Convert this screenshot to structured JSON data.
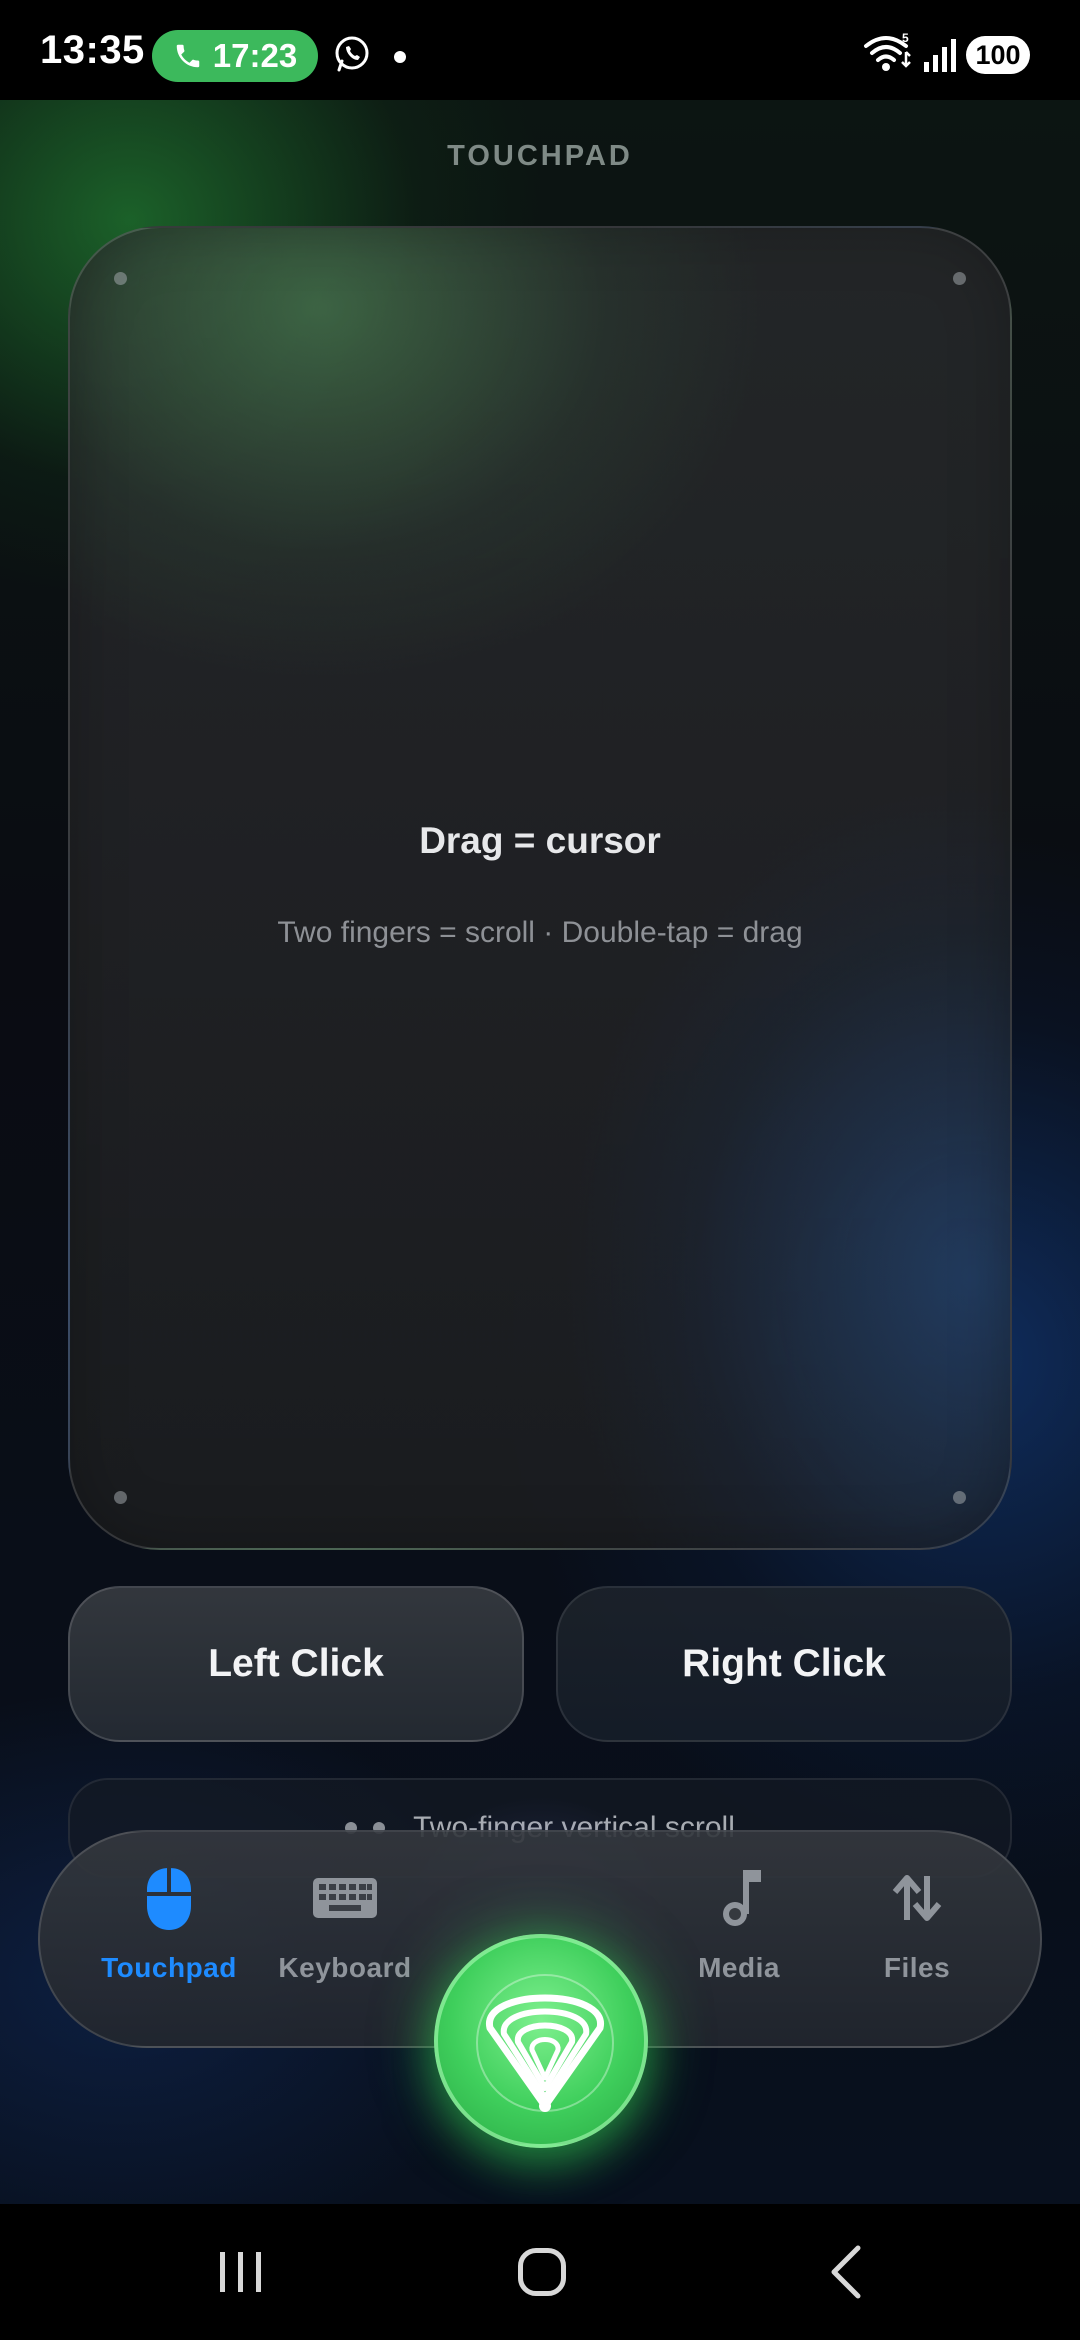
{
  "status_bar": {
    "time": "13:35",
    "call_timer": "17:23",
    "battery": "100",
    "icons": [
      "phone-icon",
      "whatsapp-icon",
      "wifi-icon",
      "signal-icon"
    ]
  },
  "page": {
    "title": "TOUCHPAD"
  },
  "touchpad": {
    "title": "Drag = cursor",
    "hint": "Two fingers = scroll · Double-tap = drag"
  },
  "buttons": {
    "left_click": "Left Click",
    "right_click": "Right Click"
  },
  "scroll_hint": {
    "text": "Two-finger vertical scroll"
  },
  "bottom_nav": {
    "items": [
      {
        "label": "Touchpad",
        "icon": "mouse-icon",
        "active": true
      },
      {
        "label": "Keyboard",
        "icon": "keyboard-icon",
        "active": false
      },
      {
        "label": "Media",
        "icon": "music-note-icon",
        "active": false
      },
      {
        "label": "Files",
        "icon": "transfer-arrows-icon",
        "active": false
      }
    ],
    "center_icon": "app-logo-icon"
  },
  "colors": {
    "accent_blue": "#1e8bff",
    "accent_green": "#3fcf5c",
    "call_pill": "#3cb95c"
  }
}
